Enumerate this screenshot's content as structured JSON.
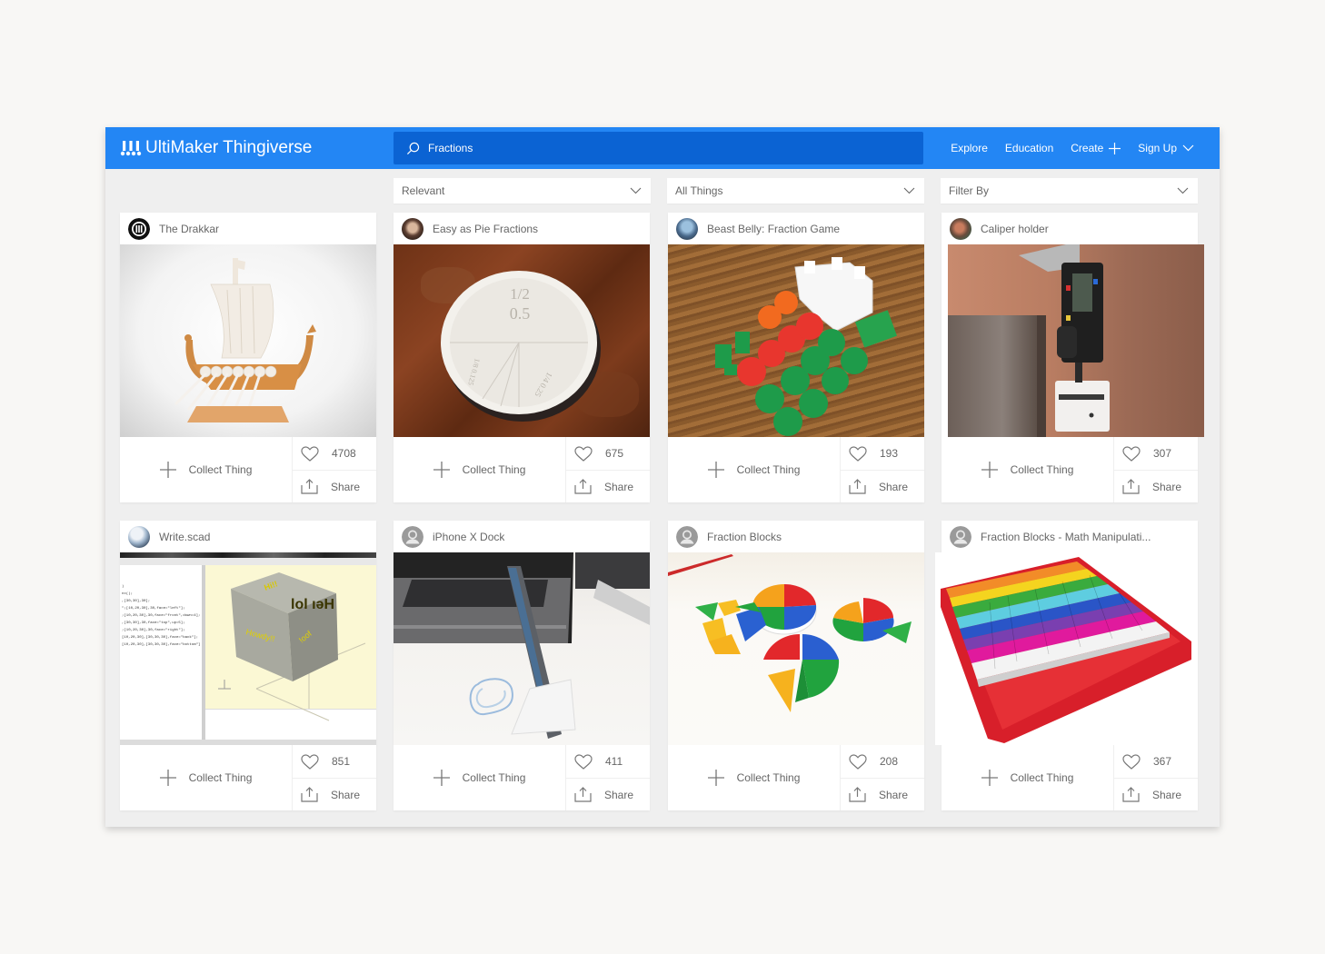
{
  "header": {
    "brand": "UltiMaker Thingiverse",
    "search_value": "Fractions",
    "nav": [
      {
        "label": "Explore"
      },
      {
        "label": "Education"
      },
      {
        "label": "Create",
        "icon": "plus-icon"
      },
      {
        "label": "Sign Up",
        "icon": "chevron-down-icon"
      }
    ]
  },
  "filters": [
    {
      "selected": "Relevant"
    },
    {
      "selected": "All Things"
    },
    {
      "selected": "Filter By"
    }
  ],
  "card_actions": {
    "collect_label": "Collect Thing",
    "share_label": "Share"
  },
  "cards": [
    {
      "title": "The Drakkar",
      "likes": "4708",
      "avatar": "ultimaker-logo-avatar",
      "image": "viking-ship-model"
    },
    {
      "title": "Easy as Pie Fractions",
      "likes": "675",
      "avatar": "user-avatar",
      "image": "fraction-pie-disc"
    },
    {
      "title": "Beast Belly: Fraction Game",
      "likes": "193",
      "avatar": "user-avatar",
      "image": "fraction-game-pieces"
    },
    {
      "title": "Caliper holder",
      "likes": "307",
      "avatar": "user-avatar",
      "image": "caliper-holder"
    },
    {
      "title": "Write.scad",
      "likes": "851",
      "avatar": "user-avatar",
      "image": "openscad-cube"
    },
    {
      "title": "iPhone X Dock",
      "likes": "411",
      "avatar": "default-avatar",
      "image": "iphone-dock"
    },
    {
      "title": "Fraction Blocks",
      "likes": "208",
      "avatar": "default-avatar",
      "image": "fraction-pie-blocks"
    },
    {
      "title": "Fraction Blocks - Math Manipulati...",
      "likes": "367",
      "avatar": "default-avatar",
      "image": "fraction-wall-tray"
    }
  ],
  "colors": {
    "brand_blue": "#2386f4",
    "search_blue": "#0b63d3"
  }
}
